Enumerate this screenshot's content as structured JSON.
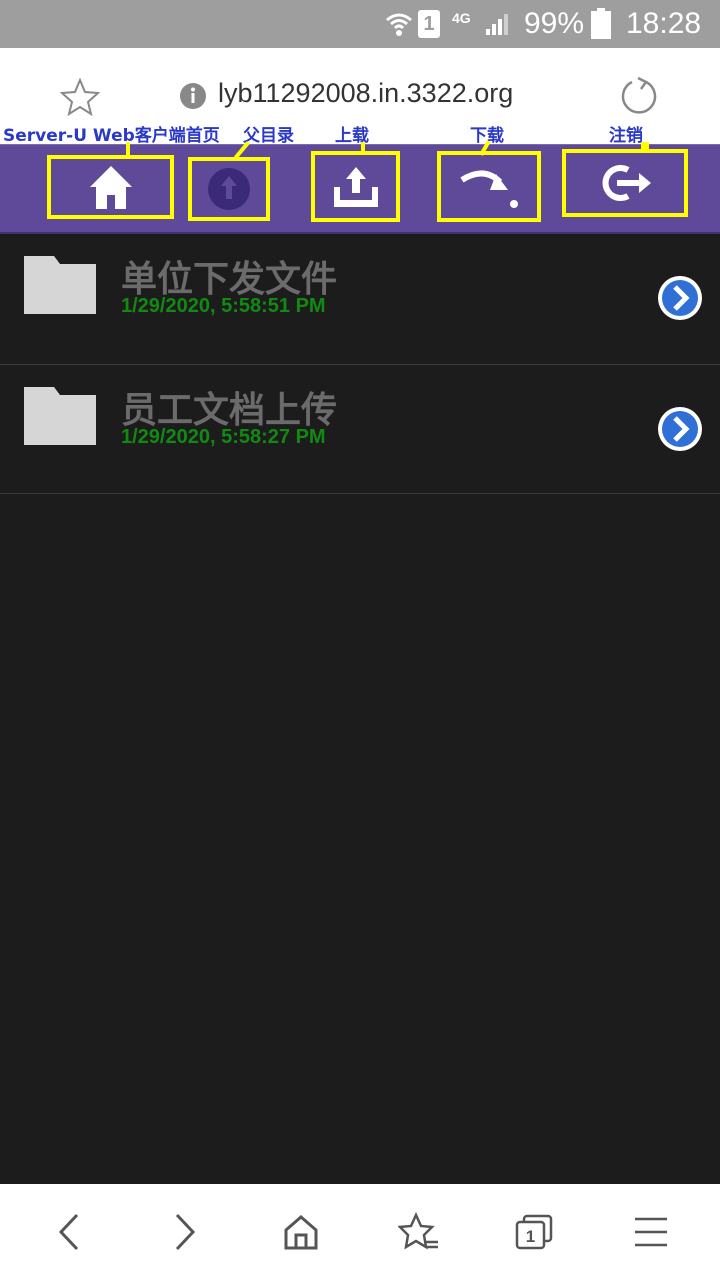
{
  "status_bar": {
    "network": "4G",
    "sim": "1",
    "battery": "99%",
    "time": "18:28"
  },
  "browser": {
    "url": "lyb11292008.in.3322.org",
    "icons": [
      "star-icon",
      "info-icon",
      "reload-icon"
    ]
  },
  "annotations": {
    "home": "Server-U Web客户端首页",
    "parent": "父目录",
    "upload": "上载",
    "download": "下载",
    "logout": "注销",
    "box_color": "#ffff00",
    "label_color": "#2a39c8"
  },
  "toolbar": {
    "color": "#5f4a9a",
    "buttons": [
      "home-icon",
      "parent-directory-icon",
      "upload-icon",
      "download-icon",
      "logout-icon"
    ]
  },
  "files": [
    {
      "name": "单位下发文件",
      "date": "1/29/2020, 5:58:51 PM"
    },
    {
      "name": "员工文档上传",
      "date": "1/29/2020, 5:58:27 PM"
    }
  ],
  "bottom_nav": [
    "back-icon",
    "forward-icon",
    "home-icon",
    "bookmarks-icon",
    "tabs-icon",
    "menu-icon"
  ],
  "bottom_nav_tab_count": "1"
}
